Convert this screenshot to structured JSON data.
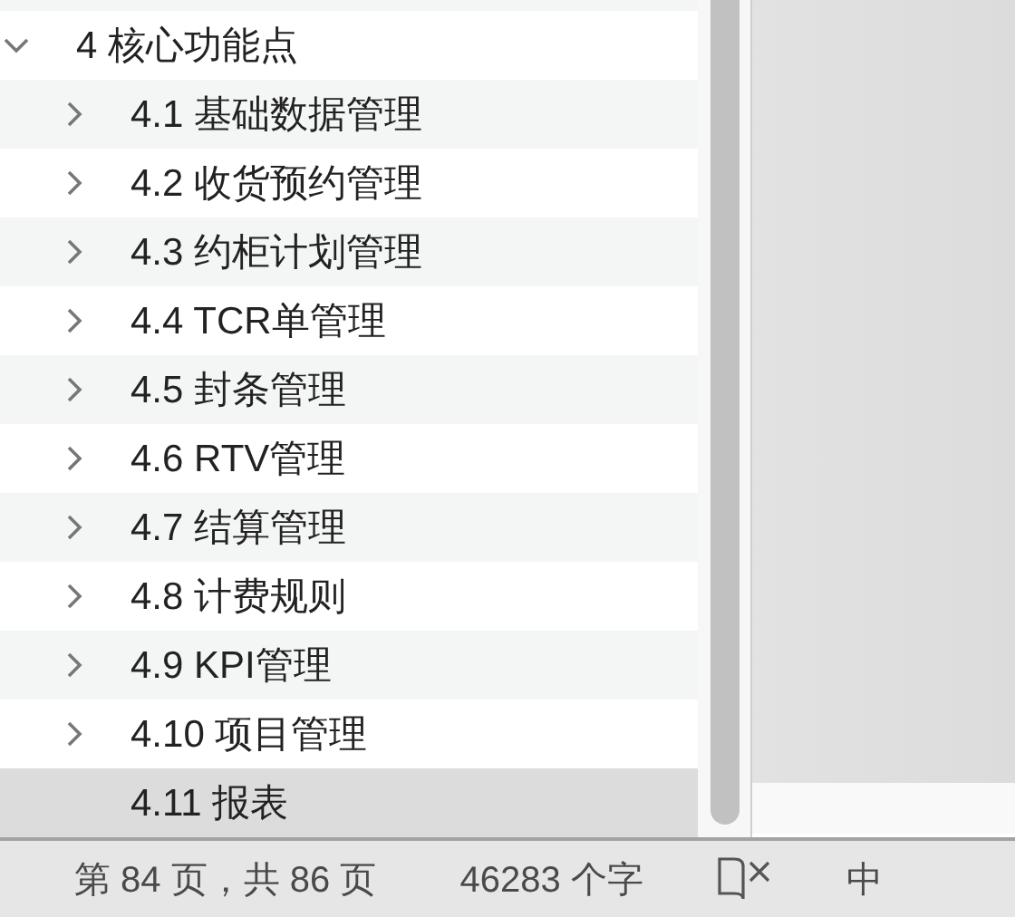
{
  "outline": {
    "items": [
      {
        "label": "4 核心功能点",
        "expanded": true,
        "selected": false,
        "children": [
          {
            "label": "4.1 基础数据管理",
            "expanded": false,
            "selected": false
          },
          {
            "label": "4.2 收货预约管理",
            "expanded": false,
            "selected": false
          },
          {
            "label": "4.3 约柜计划管理",
            "expanded": false,
            "selected": false
          },
          {
            "label": "4.4 TCR单管理",
            "expanded": false,
            "selected": false
          },
          {
            "label": "4.5 封条管理",
            "expanded": false,
            "selected": false
          },
          {
            "label": "4.6 RTV管理",
            "expanded": false,
            "selected": false
          },
          {
            "label": "4.7 结算管理",
            "expanded": false,
            "selected": false
          },
          {
            "label": "4.8 计费规则",
            "expanded": false,
            "selected": false
          },
          {
            "label": "4.9 KPI管理",
            "expanded": false,
            "selected": false
          },
          {
            "label": "4.10 项目管理",
            "expanded": false,
            "selected": false
          },
          {
            "label": "4.11 报表",
            "selected": true
          }
        ]
      }
    ]
  },
  "status_bar": {
    "page": "第 84 页，共 86 页",
    "word_count": "46283 个字",
    "language": "中"
  }
}
